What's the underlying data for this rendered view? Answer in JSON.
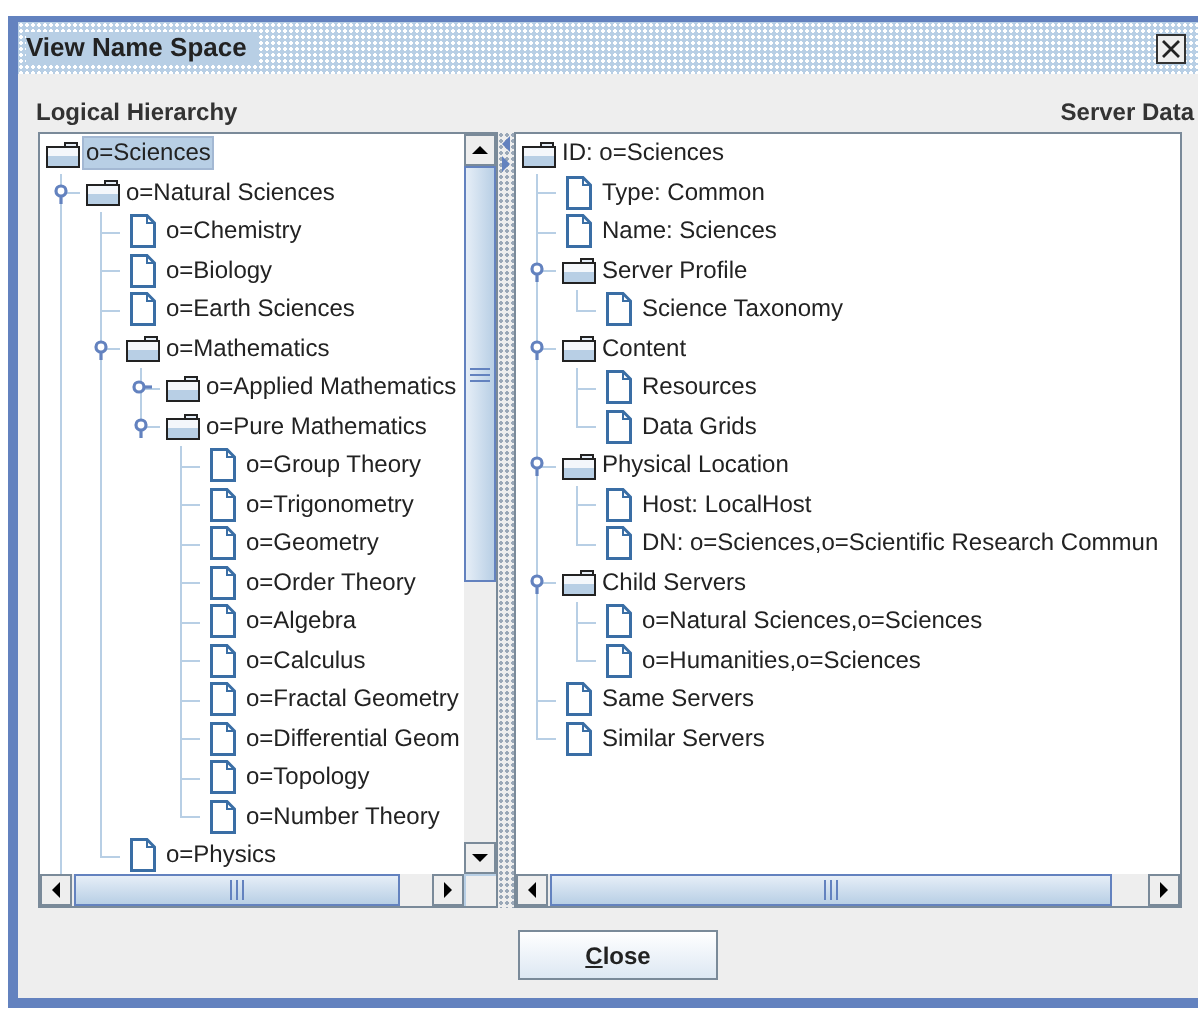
{
  "window": {
    "title": "View Name Space"
  },
  "logical_hierarchy": {
    "heading": "Logical Hierarchy",
    "more_below": true,
    "nodes": [
      {
        "label": "o=Sciences",
        "kind": "folder",
        "selected": true,
        "children": [
          {
            "label": "o=Natural Sciences",
            "kind": "folder",
            "selected": false,
            "expanded": true,
            "children": [
              {
                "label": "o=Chemistry",
                "kind": "file",
                "selected": false
              },
              {
                "label": "o=Biology",
                "kind": "file",
                "selected": false
              },
              {
                "label": "o=Earth Sciences",
                "kind": "file",
                "selected": false
              },
              {
                "label": "o=Mathematics",
                "kind": "folder",
                "selected": false,
                "expanded": true,
                "children": [
                  {
                    "label": "o=Applied Mathematics",
                    "kind": "folder",
                    "selected": false,
                    "expanded": false
                  },
                  {
                    "label": "o=Pure Mathematics",
                    "kind": "folder",
                    "selected": false,
                    "expanded": true,
                    "children": [
                      {
                        "label": "o=Group Theory",
                        "kind": "file",
                        "selected": false
                      },
                      {
                        "label": "o=Trigonometry",
                        "kind": "file",
                        "selected": false
                      },
                      {
                        "label": "o=Geometry",
                        "kind": "file",
                        "selected": false
                      },
                      {
                        "label": "o=Order Theory",
                        "kind": "file",
                        "selected": false
                      },
                      {
                        "label": "o=Algebra",
                        "kind": "file",
                        "selected": false
                      },
                      {
                        "label": "o=Calculus",
                        "kind": "file",
                        "selected": false
                      },
                      {
                        "label": "o=Fractal Geometry",
                        "kind": "file",
                        "selected": false
                      },
                      {
                        "label": "o=Differential Geom",
                        "kind": "file",
                        "selected": false
                      },
                      {
                        "label": "o=Topology",
                        "kind": "file",
                        "selected": false
                      },
                      {
                        "label": "o=Number Theory",
                        "kind": "file",
                        "selected": false
                      }
                    ]
                  }
                ]
              },
              {
                "label": "o=Physics",
                "kind": "file",
                "selected": false
              }
            ]
          }
        ]
      }
    ]
  },
  "server_data": {
    "heading": "Server Data",
    "nodes": [
      {
        "label": "ID: o=Sciences",
        "kind": "folder",
        "selected": false,
        "children": [
          {
            "label": "Type: Common",
            "kind": "file",
            "selected": false
          },
          {
            "label": "Name: Sciences",
            "kind": "file",
            "selected": false
          },
          {
            "label": "Server Profile",
            "kind": "folder",
            "selected": false,
            "expanded": true,
            "children": [
              {
                "label": "Science Taxonomy",
                "kind": "file",
                "selected": false
              }
            ]
          },
          {
            "label": "Content",
            "kind": "folder",
            "selected": false,
            "expanded": true,
            "children": [
              {
                "label": "Resources",
                "kind": "file",
                "selected": false
              },
              {
                "label": "Data Grids",
                "kind": "file",
                "selected": false
              }
            ]
          },
          {
            "label": "Physical Location",
            "kind": "folder",
            "selected": false,
            "expanded": true,
            "children": [
              {
                "label": "Host: LocalHost",
                "kind": "file",
                "selected": false
              },
              {
                "label": "DN: o=Sciences,o=Scientific Research Commun",
                "kind": "file",
                "selected": false
              }
            ]
          },
          {
            "label": "Child Servers",
            "kind": "folder",
            "selected": false,
            "expanded": true,
            "children": [
              {
                "label": "o=Natural Sciences,o=Sciences",
                "kind": "file",
                "selected": false
              },
              {
                "label": "o=Humanities,o=Sciences",
                "kind": "file",
                "selected": false
              }
            ]
          },
          {
            "label": "Same Servers",
            "kind": "file",
            "selected": false
          },
          {
            "label": "Similar Servers",
            "kind": "file",
            "selected": false
          }
        ]
      }
    ]
  },
  "buttons": [
    {
      "label": "Close"
    }
  ]
}
